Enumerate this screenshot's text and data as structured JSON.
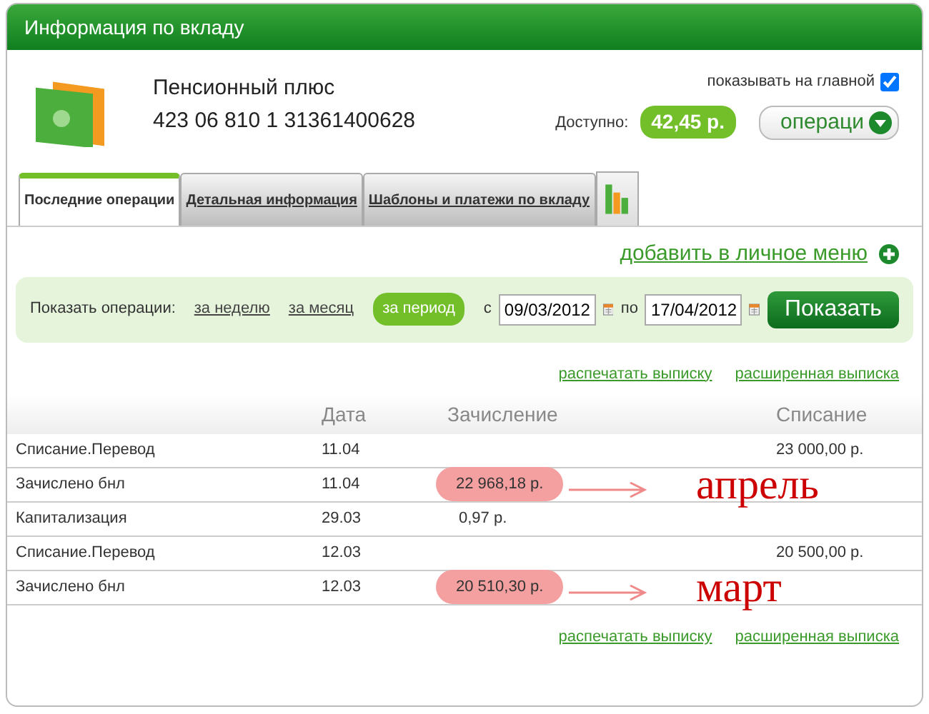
{
  "window": {
    "title": "Информация по вкладу"
  },
  "account": {
    "name": "Пенсионный плюс",
    "number": "423 06 810 1 31361400628",
    "show_on_main": {
      "label": "показывать на главной",
      "checked": true
    },
    "available_label": "Доступно:",
    "available": "42,45 р.",
    "operations_button": "операци"
  },
  "tabs": [
    {
      "label": "Последние операции",
      "selected": true
    },
    {
      "label": "Детальная информация",
      "selected": false
    },
    {
      "label": "Шаблоны и платежи по вкладу",
      "selected": false
    }
  ],
  "add_menu_link": "добавить в личное меню",
  "filter": {
    "label": "Показать операции:",
    "periods": [
      {
        "label": "за неделю",
        "selected": false
      },
      {
        "label": "за месяц",
        "selected": false
      },
      {
        "label": "за период",
        "selected": true
      }
    ],
    "from_label": "с",
    "from": "09/03/2012",
    "to_label": "по",
    "to": "17/04/2012",
    "button": "Показать"
  },
  "links_top": [
    "распечатать выписку",
    "расширенная выписка"
  ],
  "table": {
    "columns": [
      "Дата",
      "Зачисление",
      "Списание"
    ],
    "rows": [
      {
        "description": "Списание.Перевод",
        "date": "11.04",
        "credit": "",
        "debit": "23 000,00 р.",
        "highlighted": false
      },
      {
        "description": "Зачислено бнл",
        "date": "11.04",
        "credit": "22 968,18 р.",
        "debit": "",
        "highlighted": true,
        "annotation": "апрель"
      },
      {
        "description": "Капитализация",
        "date": "29.03",
        "credit": "0,97 р.",
        "debit": "",
        "highlighted": false
      },
      {
        "description": "Списание.Перевод",
        "date": "12.03",
        "credit": "",
        "debit": "20 500,00 р.",
        "highlighted": false
      },
      {
        "description": "Зачислено бнл",
        "date": "12.03",
        "credit": "20 510,30 р.",
        "debit": "",
        "highlighted": true,
        "annotation": "март"
      }
    ]
  },
  "links_bottom": [
    "распечатать выписку",
    "расширенная выписка"
  ]
}
